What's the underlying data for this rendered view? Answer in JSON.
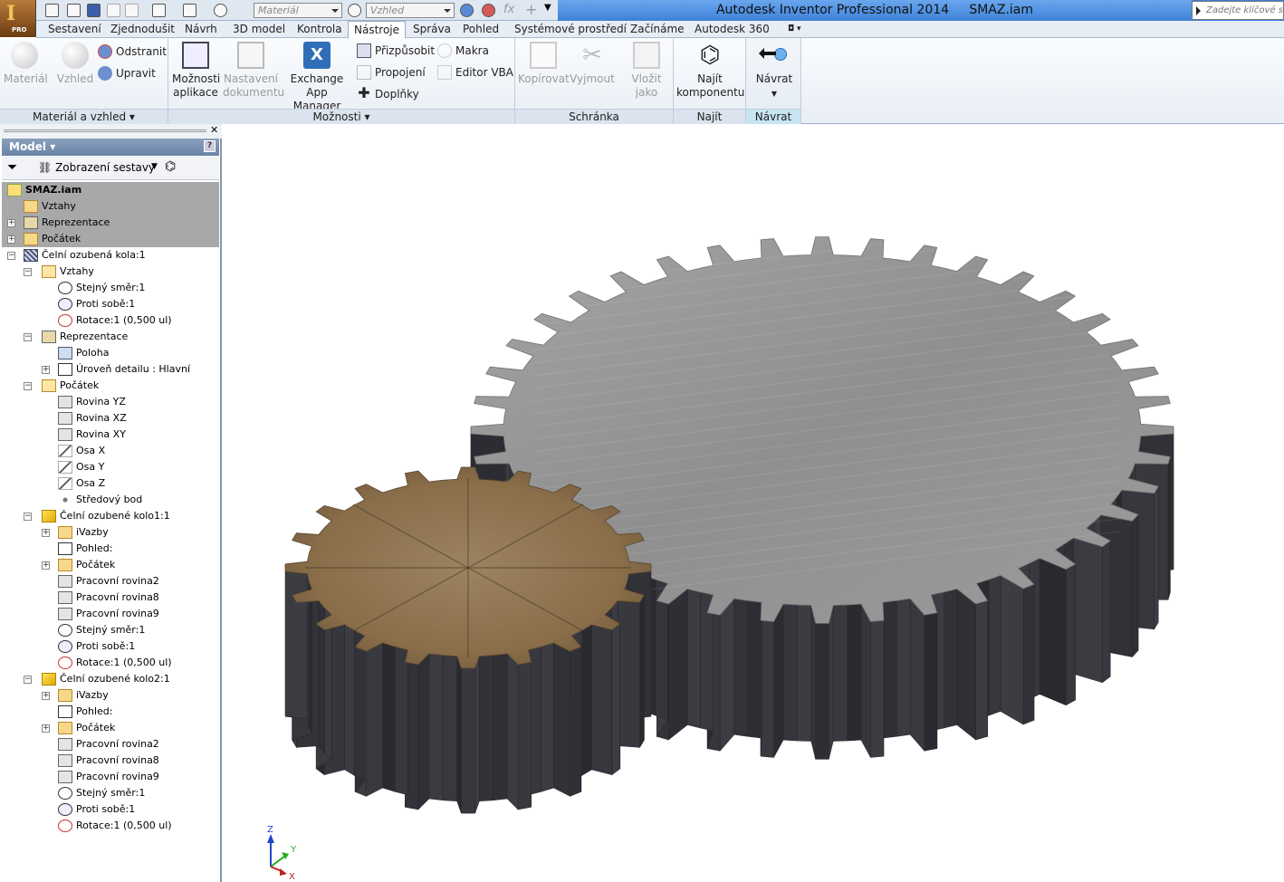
{
  "app": {
    "product_title": "Autodesk Inventor Professional 2014",
    "document_title": "SMAZ.iam",
    "logo_letter": "I",
    "logo_badge": "PRO"
  },
  "quick_access": {
    "material_select": "Materiál",
    "appearance_select": "Vzhled",
    "fx_label": "fx"
  },
  "search": {
    "placeholder": "Zadejte klíčové slo"
  },
  "tabs": [
    {
      "label": "Sestavení"
    },
    {
      "label": "Zjednodušit"
    },
    {
      "label": "Návrh"
    },
    {
      "label": "3D model"
    },
    {
      "label": "Kontrola"
    },
    {
      "label": "Nástroje",
      "active": true
    },
    {
      "label": "Správa"
    },
    {
      "label": "Pohled"
    },
    {
      "label": "Systémové prostředí"
    },
    {
      "label": "Začínáme"
    },
    {
      "label": "Autodesk 360"
    }
  ],
  "ribbon": {
    "material_panel": {
      "label": "Materiál a vzhled",
      "material": "Materiál",
      "appearance": "Vzhled",
      "remove": "Odstranit",
      "adjust": "Upravit"
    },
    "options_panel": {
      "label": "Možnosti",
      "app_options": [
        "Možnosti",
        "aplikace"
      ],
      "doc_settings": [
        "Nastavení",
        "dokumentu"
      ],
      "exchange": [
        "Exchange",
        "App Manager"
      ],
      "customize": "Přizpůsobit",
      "links": "Propojení",
      "addins": "Doplňky",
      "macros": "Makra",
      "vba": "Editor VBA"
    },
    "clipboard_panel": {
      "label": "Schránka",
      "copy": "Kopírovat",
      "cut": "Vyjmout",
      "paste_as": [
        "Vložit",
        "jako"
      ]
    },
    "find_panel": {
      "label": "Najít",
      "find_component": [
        "Najít",
        "komponentu"
      ]
    },
    "return_panel": {
      "label": "Návrat",
      "return": "Návrat"
    }
  },
  "browser": {
    "header": "Model",
    "view_mode": "Zobrazení sestavy",
    "tree": [
      {
        "label": "SMAZ.iam",
        "level": 0,
        "icon": "assembly-icon",
        "bold": true,
        "hl": true
      },
      {
        "label": "Vztahy",
        "level": 1,
        "icon": "folder-icon",
        "hl": true
      },
      {
        "label": "Reprezentace",
        "level": 1,
        "icon": "representation-icon",
        "expander": "+",
        "hl": true
      },
      {
        "label": "Počátek",
        "level": 1,
        "icon": "folder-icon",
        "expander": "+",
        "hl": true
      },
      {
        "label": "Čelní ozubená kola:1",
        "level": 1,
        "icon": "design-accelerator-icon",
        "expander": "-"
      },
      {
        "label": "Vztahy",
        "level": 2,
        "icon": "folder-open-icon",
        "expander": "-"
      },
      {
        "label": "Stejný směr:1",
        "level": 3,
        "icon": "constraint-icon"
      },
      {
        "label": "Proti sobě:1",
        "level": 3,
        "icon": "constraint-opposed-icon"
      },
      {
        "label": "Rotace:1 (0,500 ul)",
        "level": 3,
        "icon": "rotation-constraint-icon"
      },
      {
        "label": "Reprezentace",
        "level": 2,
        "icon": "representation-icon",
        "expander": "-"
      },
      {
        "label": "Poloha",
        "level": 3,
        "icon": "position-icon"
      },
      {
        "label": "Úroveň detailu : Hlavní",
        "level": 3,
        "icon": "lod-icon",
        "expander": "+"
      },
      {
        "label": "Počátek",
        "level": 2,
        "icon": "folder-open-icon",
        "expander": "-"
      },
      {
        "label": "Rovina YZ",
        "level": 3,
        "icon": "plane-icon"
      },
      {
        "label": "Rovina XZ",
        "level": 3,
        "icon": "plane-icon"
      },
      {
        "label": "Rovina XY",
        "level": 3,
        "icon": "plane-icon"
      },
      {
        "label": "Osa X",
        "level": 3,
        "icon": "axis-icon"
      },
      {
        "label": "Osa Y",
        "level": 3,
        "icon": "axis-icon"
      },
      {
        "label": "Osa Z",
        "level": 3,
        "icon": "axis-icon"
      },
      {
        "label": "Středový bod",
        "level": 3,
        "icon": "point-icon"
      },
      {
        "label": "Čelní ozubené kolo1:1",
        "level": 2,
        "icon": "part-icon",
        "expander": "-"
      },
      {
        "label": "iVazby",
        "level": 3,
        "icon": "folder-icon",
        "expander": "+"
      },
      {
        "label": "Pohled:",
        "level": 3,
        "icon": "view-rep-icon"
      },
      {
        "label": "Počátek",
        "level": 3,
        "icon": "folder-icon",
        "expander": "+"
      },
      {
        "label": "Pracovní rovina2",
        "level": 3,
        "icon": "plane-icon"
      },
      {
        "label": "Pracovní rovina8",
        "level": 3,
        "icon": "plane-icon"
      },
      {
        "label": "Pracovní rovina9",
        "level": 3,
        "icon": "plane-icon"
      },
      {
        "label": "Stejný směr:1",
        "level": 3,
        "icon": "constraint-icon"
      },
      {
        "label": "Proti sobě:1",
        "level": 3,
        "icon": "constraint-opposed-icon"
      },
      {
        "label": "Rotace:1 (0,500 ul)",
        "level": 3,
        "icon": "rotation-constraint-icon"
      },
      {
        "label": "Čelní ozubené kolo2:1",
        "level": 2,
        "icon": "part-icon",
        "expander": "-"
      },
      {
        "label": "iVazby",
        "level": 3,
        "icon": "folder-icon",
        "expander": "+"
      },
      {
        "label": "Pohled:",
        "level": 3,
        "icon": "view-rep-icon"
      },
      {
        "label": "Počátek",
        "level": 3,
        "icon": "folder-icon",
        "expander": "+"
      },
      {
        "label": "Pracovní rovina2",
        "level": 3,
        "icon": "plane-icon"
      },
      {
        "label": "Pracovní rovina8",
        "level": 3,
        "icon": "plane-icon"
      },
      {
        "label": "Pracovní rovina9",
        "level": 3,
        "icon": "plane-icon"
      },
      {
        "label": "Stejný směr:1",
        "level": 3,
        "icon": "constraint-icon"
      },
      {
        "label": "Proti sobě:1",
        "level": 3,
        "icon": "constraint-opposed-icon"
      },
      {
        "label": "Rotace:1 (0,500 ul)",
        "level": 3,
        "icon": "rotation-constraint-icon"
      }
    ]
  },
  "viewport": {
    "large_gear": {
      "teeth": 40,
      "color_top": "#9a9a9a",
      "color_side": "#3c3d44"
    },
    "small_gear": {
      "teeth": 20,
      "color_top": "#8a7050",
      "color_side": "#3c3d44"
    },
    "triad": {
      "x": "X",
      "y": "Y",
      "z": "Z"
    }
  },
  "colors": {
    "title_blue": "#3d82d8",
    "tree_highlight": "#a8a8a8",
    "model_header": "#7690b2"
  }
}
